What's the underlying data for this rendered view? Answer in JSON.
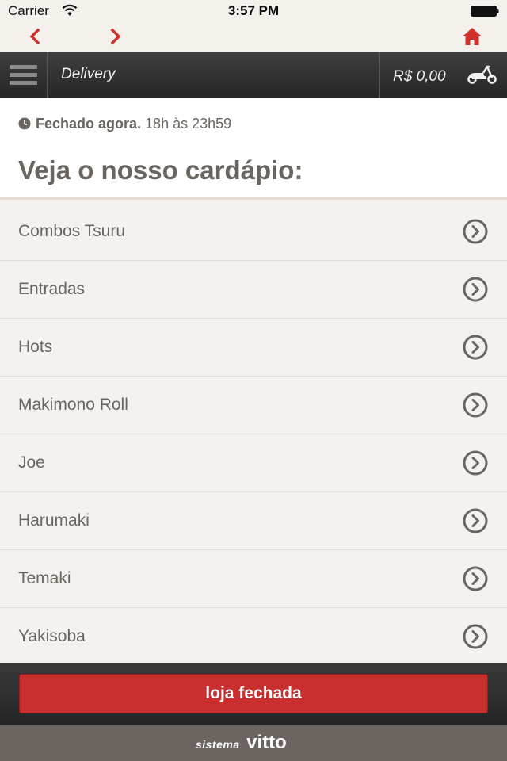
{
  "status_bar": {
    "carrier": "Carrier",
    "time": "3:57 PM"
  },
  "browser_nav": {
    "back_icon": "chevron-left-icon",
    "forward_icon": "chevron-right-icon",
    "home_icon": "home-icon",
    "accent_color": "#d0302b"
  },
  "header": {
    "menu_icon": "hamburger-icon",
    "title": "Delivery",
    "cart_total": "R$ 0,00",
    "cart_icon": "scooter-icon"
  },
  "store_info": {
    "status": "Fechado agora.",
    "hours": "18h às 23h59",
    "heading": "Veja o nosso cardápio:"
  },
  "categories": [
    {
      "label": "Combos Tsuru"
    },
    {
      "label": "Entradas"
    },
    {
      "label": "Hots"
    },
    {
      "label": "Makimono Roll"
    },
    {
      "label": "Joe"
    },
    {
      "label": "Harumaki"
    },
    {
      "label": "Temaki"
    },
    {
      "label": "Yakisoba"
    }
  ],
  "footer": {
    "button_label": "loja fechada",
    "button_color": "#c7302f"
  },
  "brand": {
    "prefix": "sistema",
    "name": "vitto"
  }
}
